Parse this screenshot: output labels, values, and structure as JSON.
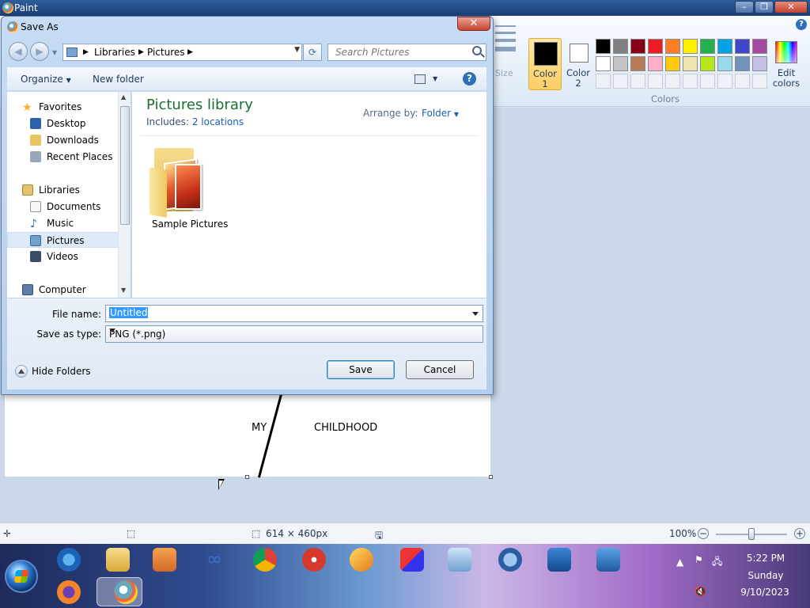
{
  "paint": {
    "title": "Paint",
    "colors": {
      "color1_label_line1": "Color",
      "color1_label_line2": "1",
      "color2_label_line1": "Color",
      "color2_label_line2": "2",
      "edit_label_line1": "Edit",
      "edit_label_line2": "colors",
      "group_label": "Colors",
      "size_label": "Size",
      "palette_row1": [
        "#000000",
        "#7f7f7f",
        "#880015",
        "#ed1c24",
        "#ff7f27",
        "#fff200",
        "#22b14c",
        "#00a2e8",
        "#3f48cc",
        "#a349a4"
      ],
      "palette_row2": [
        "#ffffff",
        "#c3c3c3",
        "#b97a57",
        "#ffaec9",
        "#ffc90e",
        "#efe4b0",
        "#b5e61d",
        "#99d9ea",
        "#7092be",
        "#c8bfe7"
      ],
      "primary": "#000000",
      "secondary": "#ffffff"
    },
    "canvas": {
      "text_left": "MY",
      "text_right": "CHILDHOOD"
    },
    "status": {
      "dimensions": "614 × 460px",
      "zoom": "100%"
    }
  },
  "dialog": {
    "title": "Save As",
    "address": {
      "segments": [
        "Libraries",
        "Pictures"
      ]
    },
    "search_placeholder": "Search Pictures",
    "toolbar": {
      "organize": "Organize",
      "new_folder": "New folder"
    },
    "nav": {
      "favorites": "Favorites",
      "desktop": "Desktop",
      "downloads": "Downloads",
      "recent_places": "Recent Places",
      "libraries": "Libraries",
      "documents": "Documents",
      "music": "Music",
      "pictures": "Pictures",
      "videos": "Videos",
      "computer": "Computer"
    },
    "library": {
      "title": "Pictures library",
      "includes_prefix": "Includes:",
      "includes_link": "2 locations",
      "arrange_by": "Arrange by:",
      "arrange_value": "Folder"
    },
    "items": [
      {
        "name": "Sample Pictures"
      }
    ],
    "file_name_label": "File name:",
    "file_name_value": "Untitled",
    "save_type_label": "Save as type:",
    "save_type_value": "PNG (*.png)",
    "hide_folders": "Hide Folders",
    "save_button": "Save",
    "cancel_button": "Cancel"
  },
  "taskbar": {
    "time": "5:22 PM",
    "day": "Sunday",
    "date": "9/10/2023",
    "pinned_icons": [
      "internet-explorer-icon",
      "file-explorer-icon",
      "media-player-icon",
      "infinity-app-icon",
      "chrome-icon",
      "game-app-icon",
      "game-app2-icon",
      "cube-app-icon",
      "search-app-icon",
      "media-center-icon",
      "computer-app-icon",
      "network-app-icon",
      "firefox-icon",
      "paint-icon"
    ]
  }
}
